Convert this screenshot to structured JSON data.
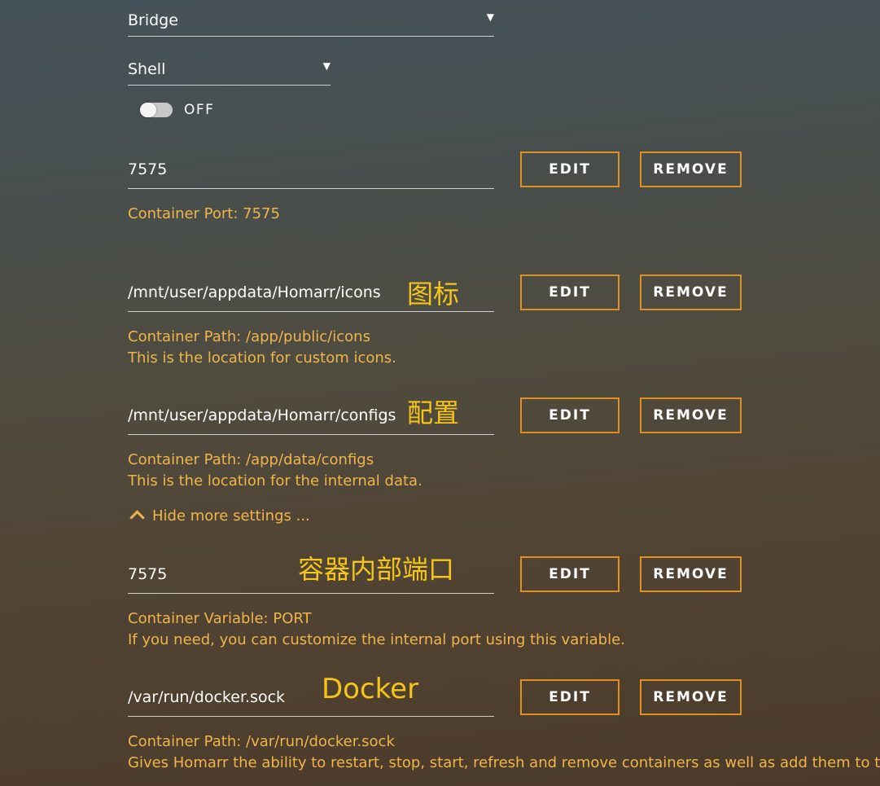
{
  "network": {
    "value": "Bridge"
  },
  "console": {
    "value": "Shell"
  },
  "privileged": {
    "state_label": "OFF"
  },
  "config_rows": [
    {
      "value": "7575",
      "annotation": "",
      "edit_label": "EDIT",
      "remove_label": "REMOVE",
      "desc_line1": "Container Port: 7575",
      "desc_line2": ""
    },
    {
      "value": "/mnt/user/appdata/Homarr/icons",
      "annotation": "图标",
      "edit_label": "EDIT",
      "remove_label": "REMOVE",
      "desc_line1": "Container Path: /app/public/icons",
      "desc_line2": "This is the location for custom icons."
    },
    {
      "value": "/mnt/user/appdata/Homarr/configs",
      "annotation": "配置",
      "edit_label": "EDIT",
      "remove_label": "REMOVE",
      "desc_line1": "Container Path: /app/data/configs",
      "desc_line2": "This is the location for the internal data."
    },
    {
      "value": "7575",
      "annotation": "容器内部端口",
      "edit_label": "EDIT",
      "remove_label": "REMOVE",
      "desc_line1": "Container Variable: PORT",
      "desc_line2": "If you need, you can customize the internal port using this variable."
    },
    {
      "value": "/var/run/docker.sock",
      "annotation": "Docker",
      "edit_label": "EDIT",
      "remove_label": "REMOVE",
      "desc_line1": "Container Path: /var/run/docker.sock",
      "desc_line2": "Gives Homarr the ability to restart, stop, start, refresh and remove containers as well as add them to the d"
    }
  ],
  "more_settings": {
    "label": "Hide more settings ...",
    "icon": "chevron-up-icon"
  },
  "colors": {
    "accent_border": "#e0901e",
    "description_text": "#f0b54a",
    "annotation_text": "#f5c518"
  }
}
